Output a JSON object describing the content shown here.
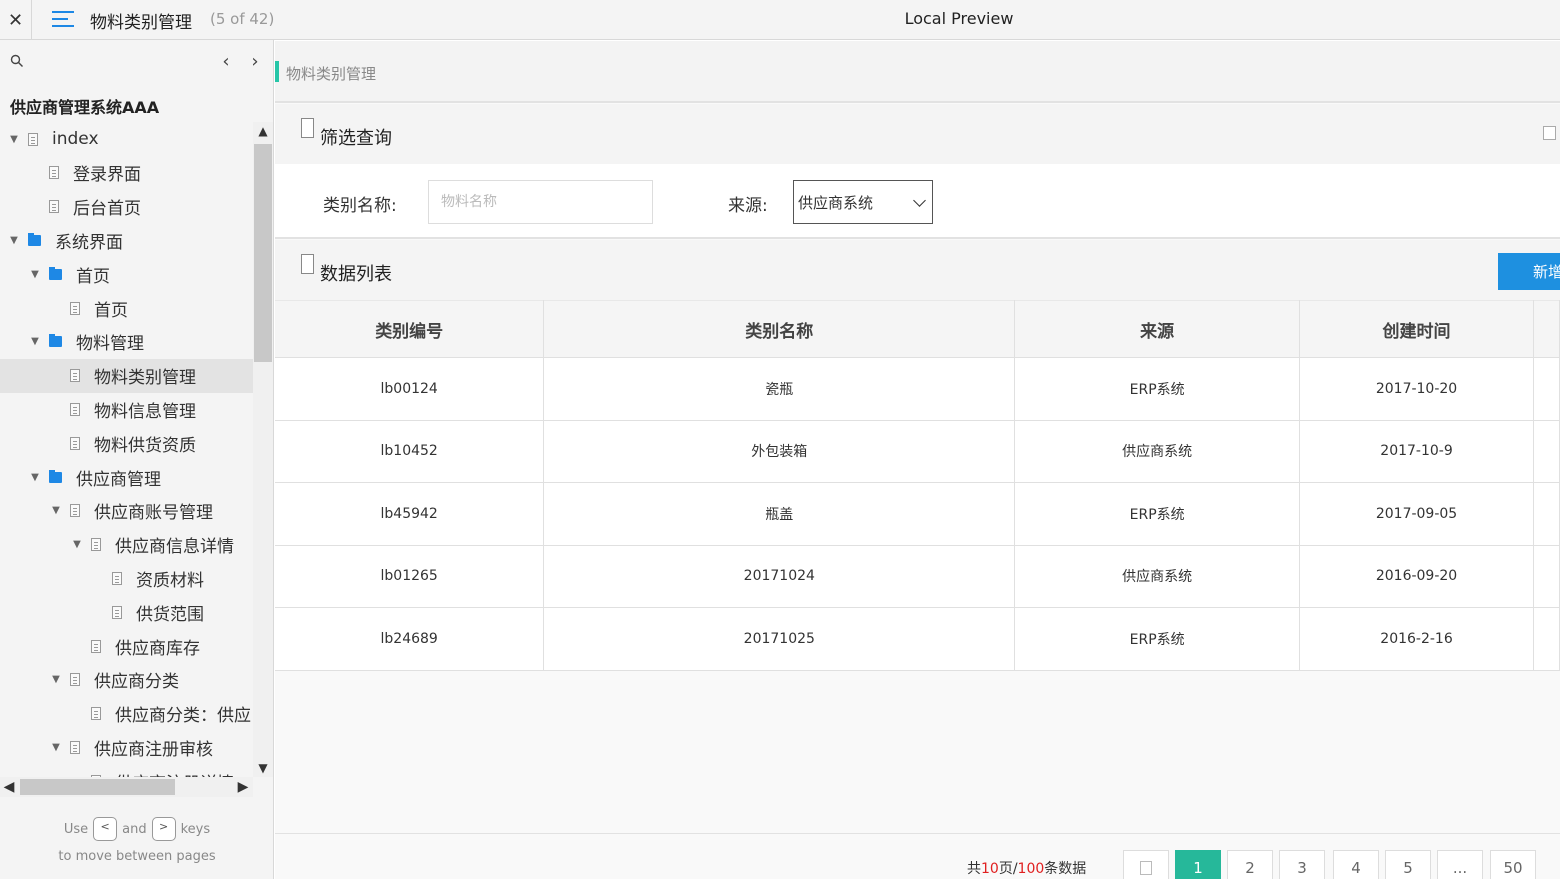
{
  "topbar": {
    "close_glyph": "✕",
    "page_title": "物料类别管理",
    "page_count": "(5 of 42)",
    "app_title": "Local Preview"
  },
  "sidebar": {
    "prev_glyph": "‹",
    "next_glyph": "›",
    "project_title": "供应商管理系统AAA",
    "tree": [
      {
        "label": "index",
        "type": "page",
        "level": 0,
        "expanded": true
      },
      {
        "label": "登录界面",
        "type": "page",
        "level": 1,
        "expanded": null
      },
      {
        "label": "后台首页",
        "type": "page",
        "level": 1,
        "expanded": null
      },
      {
        "label": "系统界面",
        "type": "folder",
        "level": 0,
        "expanded": true
      },
      {
        "label": "首页",
        "type": "folder",
        "level": 1,
        "expanded": true
      },
      {
        "label": "首页",
        "type": "page",
        "level": 2,
        "expanded": null
      },
      {
        "label": "物料管理",
        "type": "folder",
        "level": 1,
        "expanded": true
      },
      {
        "label": "物料类别管理",
        "type": "page",
        "level": 2,
        "expanded": null,
        "active": true
      },
      {
        "label": "物料信息管理",
        "type": "page",
        "level": 2,
        "expanded": null
      },
      {
        "label": "物料供货资质",
        "type": "page",
        "level": 2,
        "expanded": null
      },
      {
        "label": "供应商管理",
        "type": "folder",
        "level": 1,
        "expanded": true
      },
      {
        "label": "供应商账号管理",
        "type": "page",
        "level": 2,
        "expanded": true
      },
      {
        "label": "供应商信息详情",
        "type": "page",
        "level": 3,
        "expanded": true
      },
      {
        "label": "资质材料",
        "type": "page",
        "level": 4,
        "expanded": null
      },
      {
        "label": "供货范围",
        "type": "page",
        "level": 4,
        "expanded": null
      },
      {
        "label": "供应商库存",
        "type": "page",
        "level": 3,
        "expanded": null
      },
      {
        "label": "供应商分类",
        "type": "page",
        "level": 2,
        "expanded": true
      },
      {
        "label": "供应商分类：供应",
        "type": "page",
        "level": 3,
        "expanded": null
      },
      {
        "label": "供应商注册审核",
        "type": "page",
        "level": 2,
        "expanded": true
      },
      {
        "label": "供应商注册详情",
        "type": "page",
        "level": 3,
        "expanded": null
      }
    ],
    "hint_use": "Use",
    "hint_key_prev": "<",
    "hint_and": "and",
    "hint_key_next": ">",
    "hint_keys": "keys",
    "hint_line2": "to move between pages"
  },
  "main": {
    "breadcrumb": "物料类别管理",
    "filter_section": {
      "icon_text": "FO DE",
      "title": "筛选查询"
    },
    "filter": {
      "name_label": "类别名称:",
      "name_placeholder": "物料名称",
      "source_label": "来源:",
      "source_value": "供应商系统"
    },
    "list_section": {
      "icon_text": "FO CR",
      "title": "数据列表",
      "add_button": "新增"
    },
    "table": {
      "columns": [
        "类别编号",
        "类别名称",
        "来源",
        "创建时间"
      ],
      "rows": [
        [
          "lb00124",
          "瓷瓶",
          "ERP系统",
          "2017-10-20"
        ],
        [
          "lb10452",
          "外包装箱",
          "供应商系统",
          "2017-10-9"
        ],
        [
          "lb45942",
          "瓶盖",
          "ERP系统",
          "2017-09-05"
        ],
        [
          "lb01265",
          "20171024",
          "供应商系统",
          "2016-09-20"
        ],
        [
          "lb24689",
          "20171025",
          "ERP系统",
          "2016-2-16"
        ]
      ]
    },
    "pagination": {
      "total_prefix": "共",
      "total_pages": "10",
      "pages_unit": "页/",
      "total_records": "100",
      "records_unit": "条数据",
      "pages": [
        "1",
        "2",
        "3",
        "4",
        "5",
        "...",
        "50"
      ],
      "current": "1"
    }
  }
}
